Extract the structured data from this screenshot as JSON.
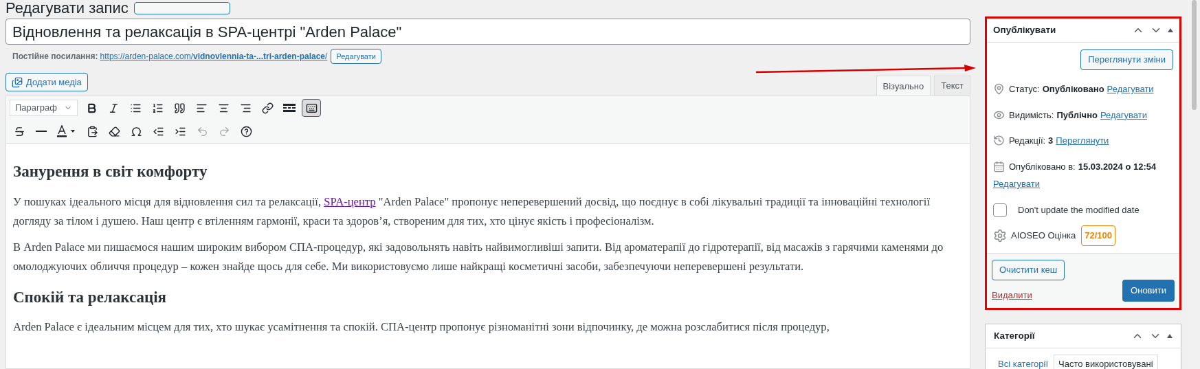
{
  "page_heading": "Редагувати запис",
  "title_field": {
    "value": "Відновлення та релаксація в SPA-центрі \"Arden Palace\""
  },
  "permalink": {
    "label": "Постійне посилання:",
    "url_start": "https://arden-palace.com/",
    "url_slug": "vidnovlennia-ta-...tri-arden-palace",
    "url_end": "/",
    "edit_button": "Редагувати"
  },
  "add_media_button": "Додати медіа",
  "editor_tabs": [
    {
      "label": "Візуально",
      "selected": true
    },
    {
      "label": "Текст",
      "selected": false
    }
  ],
  "toolbar": {
    "format_select": "Параграф",
    "rows": [
      [
        {
          "kind": "bold",
          "pressed": false,
          "disabled": false
        },
        {
          "kind": "italic",
          "pressed": false,
          "disabled": false
        },
        {
          "kind": "bullets",
          "pressed": false,
          "disabled": false
        },
        {
          "kind": "numbers",
          "pressed": false,
          "disabled": false
        },
        {
          "kind": "quote",
          "pressed": false,
          "disabled": false
        },
        {
          "kind": "align-left",
          "pressed": false,
          "disabled": false
        },
        {
          "kind": "align-center",
          "pressed": false,
          "disabled": false
        },
        {
          "kind": "align-right",
          "pressed": false,
          "disabled": false
        },
        {
          "kind": "link",
          "pressed": false,
          "disabled": false
        },
        {
          "kind": "more",
          "pressed": false,
          "disabled": false
        },
        {
          "kind": "toolbar-toggle",
          "pressed": true,
          "disabled": false
        }
      ],
      [
        {
          "kind": "strike",
          "pressed": false,
          "disabled": false
        },
        {
          "kind": "hr",
          "pressed": false,
          "disabled": false
        },
        {
          "kind": "color",
          "pressed": false,
          "disabled": false
        },
        {
          "kind": "paste",
          "pressed": false,
          "disabled": false
        },
        {
          "kind": "eraser",
          "pressed": false,
          "disabled": false
        },
        {
          "kind": "omega",
          "pressed": false,
          "disabled": false
        },
        {
          "kind": "outdent",
          "pressed": false,
          "disabled": false
        },
        {
          "kind": "indent",
          "pressed": false,
          "disabled": false
        },
        {
          "kind": "undo",
          "pressed": false,
          "disabled": true
        },
        {
          "kind": "redo",
          "pressed": false,
          "disabled": true
        },
        {
          "kind": "help",
          "pressed": false,
          "disabled": false
        }
      ]
    ]
  },
  "content": [
    {
      "kind": "heading",
      "text": "Занурення в світ комфорту"
    },
    {
      "kind": "paragraph",
      "before": "У пошуках ідеального місця для відновлення сил та релаксації, ",
      "link": "SPA-центр",
      "after": " \"Arden Palace\" пропонує неперевершений досвід, що поєднує в собі лікувальні традиції та інноваційні технології догляду за тілом і душею. Наш центр є втіленням гармонії, краси та здоров’я, створеним для тих, хто цінує якість і професіоналізм."
    },
    {
      "kind": "paragraph",
      "before": "В Arden Palace ми пишаємося нашим широким вибором СПА-процедур, які задовольнять навіть найвимогливіші запити. Від ароматерапії до гідротерапії, від масажів з гарячими каменями до омолоджуючих обличчя процедур – кожен знайде щось для себе. Ми використовуємо лише найкращі косметичні засоби, забезпечуючи неперевершені результати."
    },
    {
      "kind": "heading",
      "text": "Спокій та релаксація"
    },
    {
      "kind": "paragraph",
      "before": "Arden Palace є ідеальним місцем для тих, хто шукає усамітнення та спокій. СПА-центр пропонує різноманітні зони відпочинку, де можна розслабитися після процедур,"
    }
  ],
  "publish_box": {
    "title": "Опублікувати",
    "highlighted": true,
    "preview_button": "Переглянути зміни",
    "status": {
      "label": "Статус:",
      "value": "Опубліковано",
      "link": "Редагувати"
    },
    "visibility": {
      "label": "Видимість:",
      "value": "Публічно",
      "link": "Редагувати"
    },
    "revisions": {
      "label": "Редакції:",
      "value": "3",
      "link": "Переглянути"
    },
    "published": {
      "label": "Опубліковано в:",
      "value": "15.03.2024 о 12:54",
      "link": "Редагувати"
    },
    "dont_update": {
      "label": "Don't update the modified date",
      "checked": false
    },
    "seo": {
      "label": "AIOSEO Оцінка",
      "score": "72/100",
      "color": "#f18200"
    },
    "clear_cache_button": "Очистити кеш",
    "delete_link": "Видалити",
    "update_button": "Оновити"
  },
  "categories_box": {
    "title": "Категорії",
    "tabs": [
      {
        "label": "Всі категорії",
        "selected": false
      },
      {
        "label": "Часто використовувані",
        "selected": true
      }
    ]
  }
}
